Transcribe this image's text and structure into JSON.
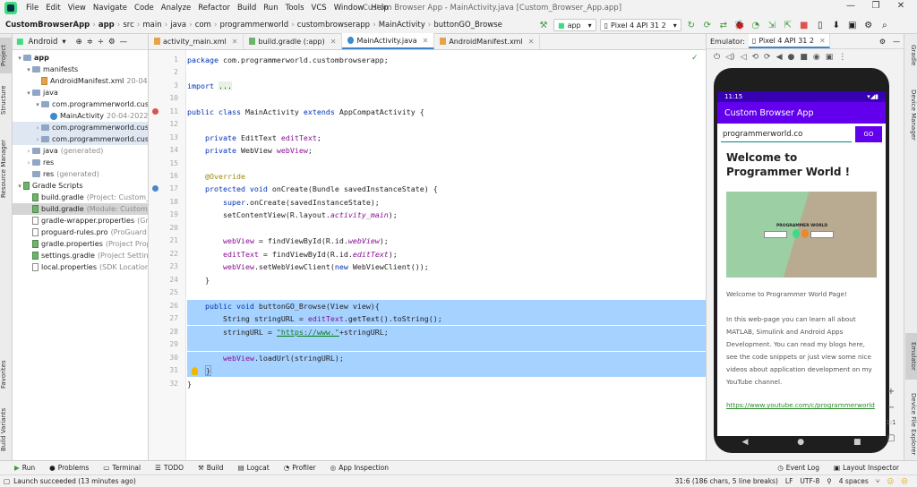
{
  "menubar": {
    "items": [
      "File",
      "Edit",
      "View",
      "Navigate",
      "Code",
      "Analyze",
      "Refactor",
      "Build",
      "Run",
      "Tools",
      "VCS",
      "Window",
      "Help"
    ],
    "window_title": "Custom Browser App - MainActivity.java [Custom_Browser_App.app]"
  },
  "breadcrumbs": [
    "CustomBrowserApp",
    "app",
    "src",
    "main",
    "java",
    "com",
    "programmerworld",
    "custombrowserapp",
    "MainActivity",
    "buttonGO_Browse"
  ],
  "toolbar": {
    "run_config": "app",
    "device": "Pixel 4 API 31 2"
  },
  "project_panel": {
    "view_mode": "Android",
    "tree": [
      {
        "label": "app",
        "indent": 0,
        "arrow": "▾",
        "icon": "folder",
        "bold": true
      },
      {
        "label": "manifests",
        "indent": 1,
        "arrow": "▾",
        "icon": "folder"
      },
      {
        "label": "AndroidManifest.xml",
        "extra": "20-04-",
        "indent": 2,
        "arrow": "",
        "icon": "x"
      },
      {
        "label": "java",
        "indent": 1,
        "arrow": "▾",
        "icon": "folder"
      },
      {
        "label": "com.programmerworld.custo",
        "indent": 2,
        "arrow": "▾",
        "icon": "folder"
      },
      {
        "label": "MainActivity",
        "extra": "20-04-2022",
        "indent": 3,
        "arrow": "",
        "icon": "c"
      },
      {
        "label": "com.programmerworld.custo",
        "indent": 2,
        "arrow": "›",
        "icon": "folder",
        "hl": true
      },
      {
        "label": "com.programmerworld.custo",
        "indent": 2,
        "arrow": "›",
        "icon": "folder",
        "hl": true
      },
      {
        "label": "java",
        "extra": "(generated)",
        "indent": 1,
        "arrow": "›",
        "icon": "folder"
      },
      {
        "label": "res",
        "indent": 1,
        "arrow": "›",
        "icon": "folder"
      },
      {
        "label": "res",
        "extra": "(generated)",
        "indent": 1,
        "arrow": "",
        "icon": "folder"
      },
      {
        "label": "Gradle Scripts",
        "indent": 0,
        "arrow": "▾",
        "icon": "g"
      },
      {
        "label": "build.gradle",
        "extra": "(Project: Custom_B",
        "indent": 1,
        "arrow": "",
        "icon": "g"
      },
      {
        "label": "build.gradle",
        "extra": "(Module: Custom_B",
        "indent": 1,
        "arrow": "",
        "icon": "g",
        "sel": true
      },
      {
        "label": "gradle-wrapper.properties",
        "extra": "(Gra",
        "indent": 1,
        "arrow": "",
        "icon": "f"
      },
      {
        "label": "proguard-rules.pro",
        "extra": "(ProGuard R",
        "indent": 1,
        "arrow": "",
        "icon": "f"
      },
      {
        "label": "gradle.properties",
        "extra": "(Project Prope",
        "indent": 1,
        "arrow": "",
        "icon": "g"
      },
      {
        "label": "settings.gradle",
        "extra": "(Project Setting",
        "indent": 1,
        "arrow": "",
        "icon": "g"
      },
      {
        "label": "local.properties",
        "extra": "(SDK Location)",
        "indent": 1,
        "arrow": "",
        "icon": "f"
      }
    ]
  },
  "editor_tabs": [
    {
      "label": "activity_main.xml",
      "active": false
    },
    {
      "label": "build.gradle (:app)",
      "active": false
    },
    {
      "label": "MainActivity.java",
      "active": true
    },
    {
      "label": "AndroidManifest.xml",
      "active": false
    }
  ],
  "code_lines": [
    {
      "n": "1",
      "html": "<span class=\"kw\">package</span> com.programmerworld.custombrowserapp;"
    },
    {
      "n": "2",
      "html": ""
    },
    {
      "n": "3",
      "html": "<span class=\"kw\">import</span> <span style=\"background:#e8f2e4\">...</span>"
    },
    {
      "n": "10",
      "html": ""
    },
    {
      "n": "11",
      "html": "<span class=\"kw\">public class</span> MainActivity <span class=\"kw\">extends</span> AppCompatActivity {"
    },
    {
      "n": "12",
      "html": ""
    },
    {
      "n": "13",
      "html": "    <span class=\"kw\">private</span> EditText <span class=\"fld\">editText</span>;"
    },
    {
      "n": "14",
      "html": "    <span class=\"kw\">private</span> WebView <span class=\"fld\">webView</span>;"
    },
    {
      "n": "15",
      "html": ""
    },
    {
      "n": "16",
      "html": "    <span class=\"ann\">@Override</span>"
    },
    {
      "n": "17",
      "html": "    <span class=\"kw\">protected void</span> onCreate(Bundle savedInstanceState) {"
    },
    {
      "n": "18",
      "html": "        <span class=\"kw\">super</span>.onCreate(savedInstanceState);"
    },
    {
      "n": "19",
      "html": "        setContentView(R.layout.<span class=\"fld it\">activity_main</span>);"
    },
    {
      "n": "20",
      "html": ""
    },
    {
      "n": "21",
      "html": "        <span class=\"fld\">webView</span> = findViewById(R.id.<span class=\"fld it\">webView</span>);"
    },
    {
      "n": "22",
      "html": "        <span class=\"fld\">editText</span> = findViewById(R.id.<span class=\"fld it\">editText</span>);"
    },
    {
      "n": "23",
      "html": "        <span class=\"fld\">webView</span>.setWebViewClient(<span class=\"kw\">new</span> WebViewClient());"
    },
    {
      "n": "24",
      "html": "    }"
    },
    {
      "n": "25",
      "html": ""
    },
    {
      "n": "26",
      "html": "    <span class=\"kw\">public void</span> buttonGO_Browse(View view){",
      "sel": true
    },
    {
      "n": "27",
      "html": "        String stringURL = <span class=\"fld\">editText</span>.getText().toString();",
      "sel": true
    },
    {
      "n": "28",
      "html": "        stringURL = <span class=\"str\">\"https://www.\"</span>+stringURL;",
      "sel": true
    },
    {
      "n": "29",
      "html": "",
      "sel": true
    },
    {
      "n": "30",
      "html": "        <span class=\"fld\">webView</span>.loadUrl(stringURL);",
      "sel": true
    },
    {
      "n": "31",
      "html": "    <span style=\"border:1px solid #7aa0d6\">}</span>",
      "sel": true
    },
    {
      "n": "32",
      "html": "}"
    }
  ],
  "emulator": {
    "label": "Emulator:",
    "tab": "Pixel 4 API 31 2",
    "time": "11:15",
    "app_title": "Custom Browser App",
    "url_value": "programmerworld.co",
    "go_label": "GO",
    "heading": "Welcome to Programmer World !",
    "image_title": "PROGRAMMER WORLD",
    "para1": "Welcome to Programmer World Page!",
    "para2": "In this web-page you can learn all about MATLAB, Simulink and Android Apps Development. You can read my blogs here, see the code snippets or just view some nice videos about application development on my YouTube channel.",
    "link": "https://www.youtube.com/c/programmerworld",
    "zoom_ratio": "1:1"
  },
  "left_tabs": [
    "Project",
    "Structure",
    "Resource Manager",
    "Favorites",
    "Build Variants"
  ],
  "right_tabs": [
    "Gradle",
    "Device Manager",
    "Emulator",
    "Device File Explorer"
  ],
  "bottom_tools": [
    {
      "label": "Run",
      "icon": "play-icon"
    },
    {
      "label": "Problems",
      "icon": "problems-icon"
    },
    {
      "label": "Terminal",
      "icon": "terminal-icon"
    },
    {
      "label": "TODO",
      "icon": "todo-icon"
    },
    {
      "label": "Build",
      "icon": "hammer-icon"
    },
    {
      "label": "Logcat",
      "icon": "logcat-icon"
    },
    {
      "label": "Profiler",
      "icon": "profiler-icon"
    },
    {
      "label": "App Inspection",
      "icon": "inspection-icon"
    }
  ],
  "bottom_right_tools": [
    {
      "label": "Event Log"
    },
    {
      "label": "Layout Inspector"
    }
  ],
  "status": {
    "message": "Launch succeeded (13 minutes ago)",
    "position": "31:6 (186 chars, 5 line breaks)",
    "line_sep": "LF",
    "encoding": "UTF-8",
    "indent": "4 spaces"
  }
}
